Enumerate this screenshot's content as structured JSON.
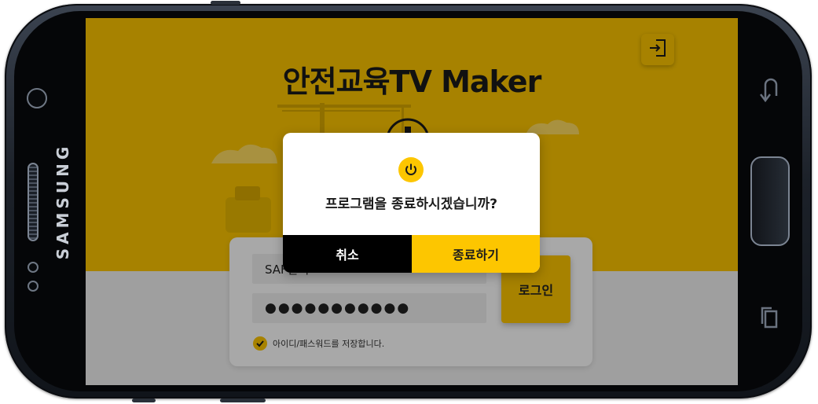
{
  "device": {
    "brand": "SAMSUNG",
    "nav_icons": {
      "back": "back-arrow-icon",
      "recents": "recent-apps-icon"
    }
  },
  "app": {
    "title": "안전교육TV Maker",
    "exit_icon": "exit-door-icon",
    "brand_color": "#fdc600"
  },
  "login": {
    "id_value": "SAF관리",
    "password_value": "●●●●●●●●●●●",
    "login_label": "로그인",
    "remember_label": "아이디/패스워드를 저장합니다.",
    "remember_checked": true
  },
  "dialog": {
    "icon": "power-icon",
    "message": "프로그램을 종료하시겠습니까?",
    "cancel_label": "취소",
    "quit_label": "종료하기"
  }
}
